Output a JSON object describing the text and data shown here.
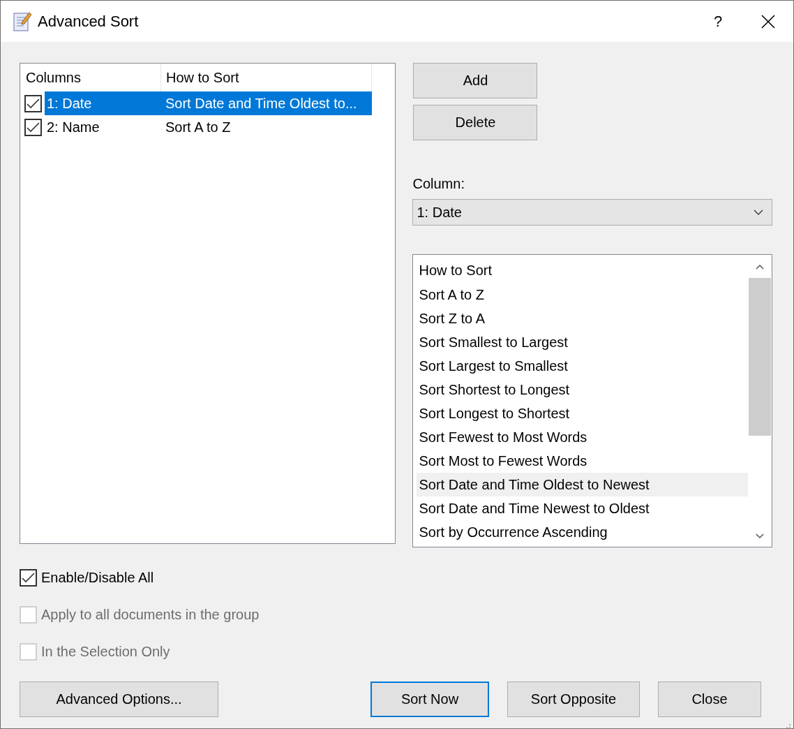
{
  "window": {
    "title": "Advanced Sort",
    "help": "?"
  },
  "sort_table": {
    "columns": [
      "Columns",
      "How to Sort"
    ],
    "rows": [
      {
        "column": "1: Date",
        "how": "Sort Date and Time Oldest to...",
        "checked": true,
        "selected": true
      },
      {
        "column": "2: Name",
        "how": "Sort A to Z",
        "checked": true,
        "selected": false
      }
    ]
  },
  "side_buttons": [
    "Add",
    "Delete"
  ],
  "column_field": {
    "label": "Column:",
    "value": "1: Date"
  },
  "how_list": {
    "header": "How to Sort",
    "items": [
      {
        "label": "Sort A to Z",
        "selected": false
      },
      {
        "label": "Sort Z to A",
        "selected": false
      },
      {
        "label": "Sort Smallest to Largest",
        "selected": false
      },
      {
        "label": "Sort Largest to Smallest",
        "selected": false
      },
      {
        "label": "Sort Shortest to Longest",
        "selected": false
      },
      {
        "label": "Sort Longest to Shortest",
        "selected": false
      },
      {
        "label": "Sort Fewest to Most Words",
        "selected": false
      },
      {
        "label": "Sort Most to Fewest Words",
        "selected": false
      },
      {
        "label": "Sort Date and Time Oldest to Newest",
        "selected": true
      },
      {
        "label": "Sort Date and Time Newest to Oldest",
        "selected": false
      },
      {
        "label": "Sort by Occurrence Ascending",
        "selected": false
      }
    ]
  },
  "options": [
    {
      "label": "Enable/Disable All",
      "checked": true,
      "disabled": false
    },
    {
      "label": "Apply to all documents in the group",
      "checked": false,
      "disabled": true
    },
    {
      "label": "In the Selection Only",
      "checked": false,
      "disabled": true
    }
  ],
  "footer_buttons": [
    {
      "label": "Advanced Options...",
      "default": false
    },
    {
      "label": "Sort Now",
      "default": true
    },
    {
      "label": "Sort Opposite",
      "default": false
    },
    {
      "label": "Close",
      "default": false
    }
  ]
}
